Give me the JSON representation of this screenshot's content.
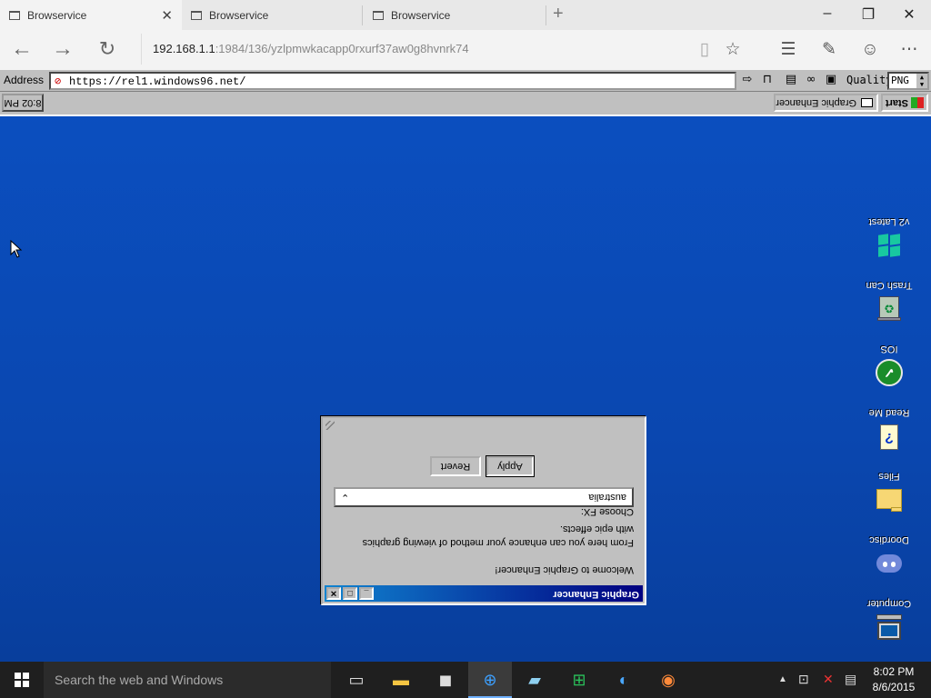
{
  "browser": {
    "tabs": [
      {
        "title": "Browservice"
      },
      {
        "title": "Browservice"
      },
      {
        "title": "Browservice"
      }
    ],
    "new_tab_glyph": "+",
    "window_controls": {
      "minimize": "–",
      "maximize": "❐",
      "close": "✕"
    },
    "url": {
      "host": "192.168.1.1",
      "rest": ":1984/136/yzlpmwkacapp0rxurf37aw0g8hvnrk74"
    }
  },
  "retro_bar": {
    "address_label": "Address",
    "address_url": "https://rel1.windows96.net/",
    "quality_label": "Quality",
    "quality_value": "PNG"
  },
  "w96": {
    "start_label": "Start",
    "task_label": "Graphic Enhancer",
    "clock": "8:02 PM",
    "desktop_icons": [
      {
        "label": "v2 Latest",
        "icon": "windows-logo-icon"
      },
      {
        "label": "Trash Can",
        "icon": "trash-can-icon"
      },
      {
        "label": "IOS",
        "icon": "ios-icon"
      },
      {
        "label": "Read Me",
        "icon": "help-document-icon"
      },
      {
        "label": "Files",
        "icon": "folder-icon"
      },
      {
        "label": "Doordisc",
        "icon": "discord-icon"
      },
      {
        "label": "Computer",
        "icon": "computer-icon"
      }
    ],
    "window": {
      "title": "Graphic Enhancer",
      "welcome": "Welcome to Graphic Enhancer!",
      "description_line1": "From here you can enhance your method of viewing graphics",
      "description_line2": "with epic effects.",
      "choose_label": "Choose FX:",
      "selected_fx": "australia",
      "apply_label": "Apply",
      "revert_label": "Revert"
    }
  },
  "taskbar": {
    "search_placeholder": "Search the web and Windows",
    "clock_time": "8:02 PM",
    "clock_date": "8/6/2015"
  }
}
